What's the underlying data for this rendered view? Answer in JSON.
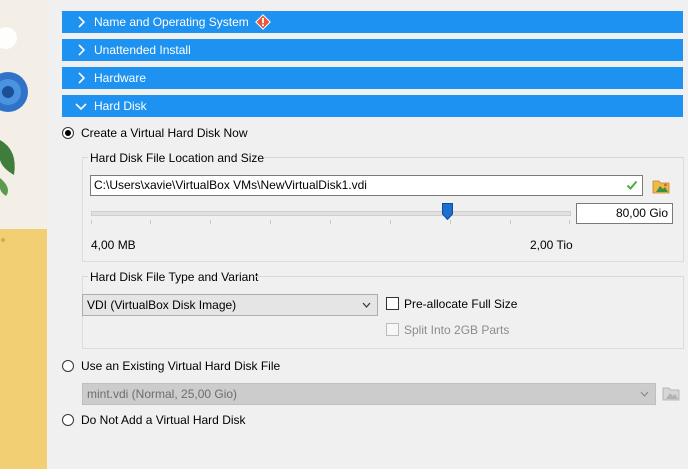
{
  "sections": [
    {
      "label": "Name and Operating System",
      "state": "collapsed",
      "warning": true
    },
    {
      "label": "Unattended Install",
      "state": "collapsed"
    },
    {
      "label": "Hardware",
      "state": "collapsed"
    },
    {
      "label": "Hard Disk",
      "state": "expanded"
    }
  ],
  "hard_disk": {
    "option_create": "Create a Virtual Hard Disk Now",
    "location_group": {
      "title": "Hard Disk File Location and Size",
      "path_value": "C:\\Users\\xavie\\VirtualBox VMs\\NewVirtualDisk1.vdi",
      "size_value": "80,00 Gio",
      "slider_min_label": "4,00 MB",
      "slider_max_label": "2,00 Tio",
      "slider_fraction": 0.745
    },
    "type_group": {
      "title": "Hard Disk File Type and Variant",
      "type_selected": "VDI (VirtualBox Disk Image)",
      "preallocate_label": "Pre-allocate Full Size",
      "split_label": "Split Into 2GB Parts"
    },
    "option_existing": "Use an Existing Virtual Hard Disk File",
    "existing_selected": "mint.vdi (Normal, 25,00 Gio)",
    "option_none": "Do Not Add a Virtual Hard Disk",
    "selected_option": "create"
  },
  "colors": {
    "section_bar": "#1d92f0",
    "warning": "#e8573a",
    "art_yellow": "#f2cf72",
    "art_blue": "#2f73c9"
  },
  "icons": [
    "chevron-right-icon",
    "chevron-down-icon",
    "warning-icon",
    "check-icon",
    "folder-icon"
  ]
}
